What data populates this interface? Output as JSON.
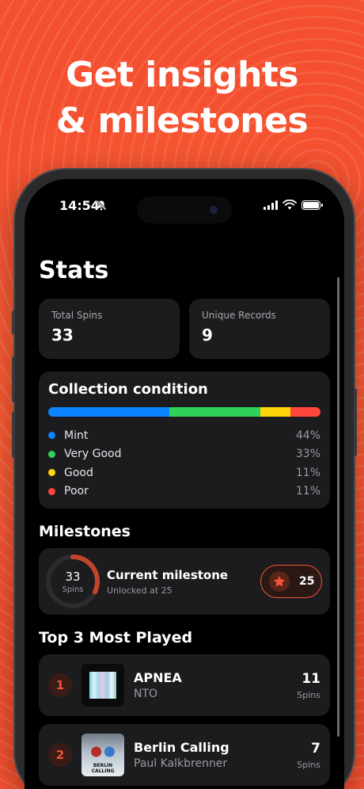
{
  "promo": {
    "line1": "Get insights",
    "line2": "& milestones"
  },
  "status": {
    "time": "14:54"
  },
  "page": {
    "title": "Stats"
  },
  "stats": [
    {
      "label": "Total Spins",
      "value": "33"
    },
    {
      "label": "Unique Records",
      "value": "9"
    }
  ],
  "condition": {
    "title": "Collection condition",
    "items": [
      {
        "label": "Mint",
        "pct": "44%",
        "value": 44,
        "color": "#0a84ff"
      },
      {
        "label": "Very Good",
        "pct": "33%",
        "value": 33,
        "color": "#30d158"
      },
      {
        "label": "Good",
        "pct": "11%",
        "value": 11,
        "color": "#ffd60a"
      },
      {
        "label": "Poor",
        "pct": "11%",
        "value": 11,
        "color": "#ff453a"
      }
    ]
  },
  "milestones": {
    "section": "Milestones",
    "spins": "33",
    "spins_label": "Spins",
    "progress": 0.32,
    "title": "Current milestone",
    "subtitle": "Unlocked at 25",
    "badge": "25",
    "accent": "#f0553a"
  },
  "top": {
    "section": "Top 3 Most Played",
    "items": [
      {
        "rank": "1",
        "title": "APNEA",
        "artist": "NTO",
        "spins": "11",
        "spins_label": "Spins"
      },
      {
        "rank": "2",
        "title": "Berlin Calling",
        "artist": "Paul Kalkbrenner",
        "spins": "7",
        "spins_label": "Spins",
        "art_text": "BERLIN CALLING"
      }
    ]
  }
}
